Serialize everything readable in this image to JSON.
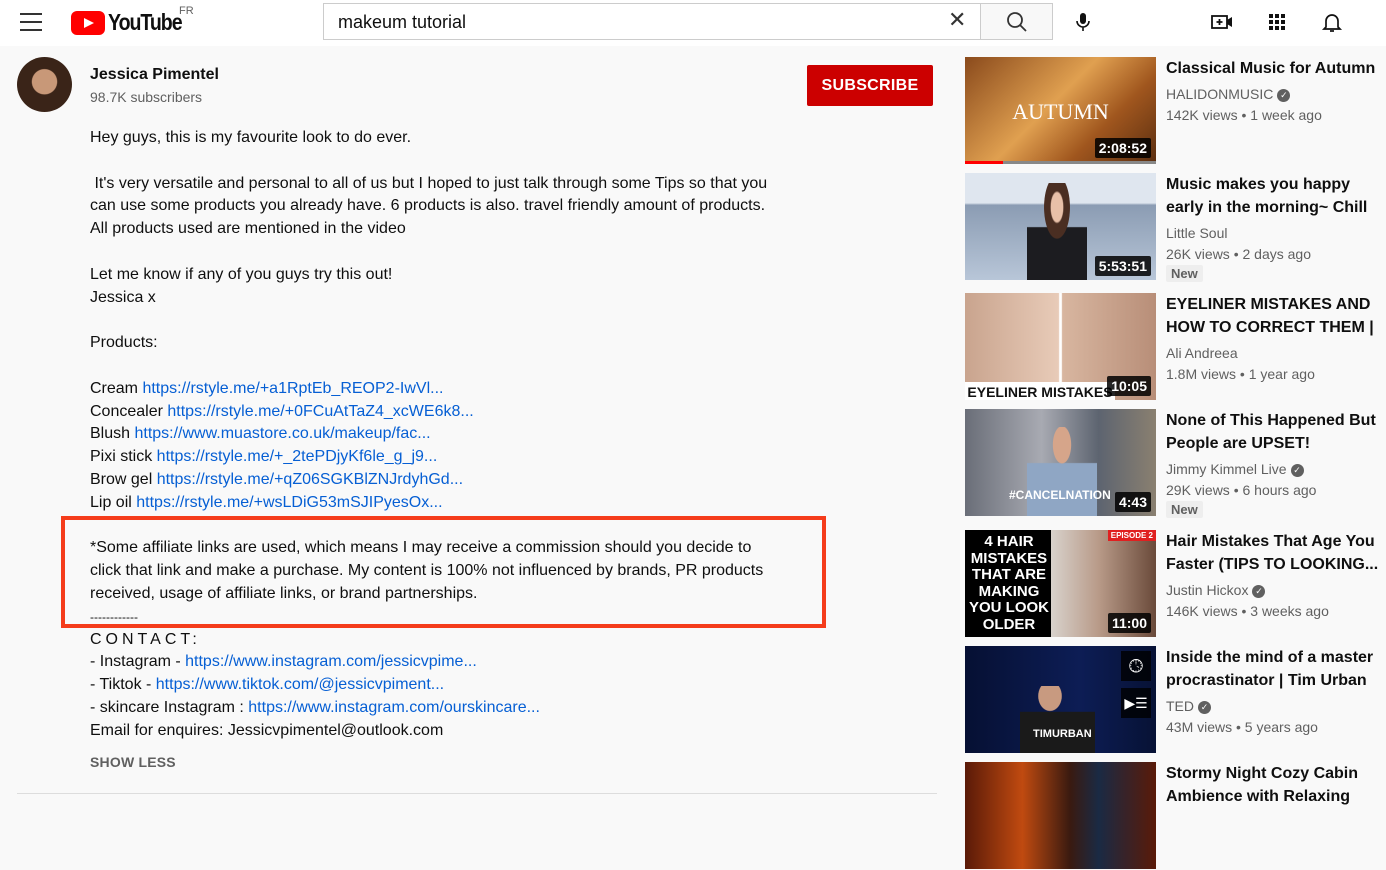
{
  "header": {
    "logo_text": "YouTube",
    "region": "FR",
    "search_value": "makeum tutorial"
  },
  "channel": {
    "name": "Jessica Pimentel",
    "subscribers": "98.7K subscribers",
    "subscribe_label": "SUBSCRIBE"
  },
  "description": {
    "intro": "Hey guys, this is my favourite look to do ever.",
    "p2": [
      " It's very versatile and personal to all of us but I hoped to just talk through some Tips so that you",
      "can use some products you already have. 6 products is also. travel friendly amount of products.",
      "All products used are mentioned in the video"
    ],
    "p3": [
      "Let me know if any of you guys try this out!",
      "Jessica x"
    ],
    "products_heading": "Products:",
    "products": [
      {
        "label": "Cream ",
        "link": "https://rstyle.me/+a1RptEb_REOP2-IwVl..."
      },
      {
        "label": "Concealer ",
        "link": "https://rstyle.me/+0FCuAtTaZ4_xcWE6k8..."
      },
      {
        "label": "Blush ",
        "link": "https://www.muastore.co.uk/makeup/fac..."
      },
      {
        "label": "Pixi stick ",
        "link": "https://rstyle.me/+_2tePDjyKf6le_g_j9..."
      },
      {
        "label": "Brow gel ",
        "link": "https://rstyle.me/+qZ06SGKBlZNJrdyhGd..."
      },
      {
        "label": "Lip oil ",
        "link": "https://rstyle.me/+wsLDiG53mSJIPyesOx..."
      }
    ],
    "affiliate": [
      "*Some affiliate links are used, which means I may receive a commission should you decide to",
      "click that link and make a purchase. My content is 100% not influenced by brands, PR products",
      "received, usage of affiliate links, or brand partnerships."
    ],
    "separator": "------------",
    "contact_heading": "CONTACT:",
    "contacts": [
      {
        "label": "- Instagram - ",
        "link": "https://www.instagram.com/jessicvpime..."
      },
      {
        "label": "- Tiktok - ",
        "link": "https://www.tiktok.com/@jessicvpiment..."
      },
      {
        "label": "- skincare Instagram : ",
        "link": "https://www.instagram.com/ourskincare..."
      }
    ],
    "email": "Email for enquires: Jessicvpimentel@outlook.com",
    "show_less": "SHOW LESS",
    "highlight_color": "#f53c1b"
  },
  "sidebar": [
    {
      "title": "Classical Music for Autumn",
      "channel": "HALIDONMUSIC",
      "verified": true,
      "meta": "142K views • 1 week ago",
      "duration": "2:08:52",
      "thumb_text": "AUTUMN",
      "watched": 0.2
    },
    {
      "title": "Music makes you happy early in the morning~ Chill beats -...",
      "channel": "Little Soul",
      "meta": "26K views • 2 days ago",
      "duration": "5:53:51",
      "badge": "New"
    },
    {
      "title": "EYELINER MISTAKES AND HOW TO CORRECT THEM | A...",
      "channel": "Ali Andreea",
      "meta": "1.8M views • 1 year ago",
      "duration": "10:05",
      "thumb_text": "EYELINER MISTAKES"
    },
    {
      "title": "None of This Happened But People are UPSET!",
      "channel": "Jimmy Kimmel Live",
      "verified": true,
      "meta": "29K views • 6 hours ago",
      "duration": "4:43",
      "badge": "New",
      "thumb_text": "#CANCELNATION"
    },
    {
      "title": "Hair Mistakes That Age You Faster (TIPS TO LOOKING...",
      "channel": "Justin Hickox",
      "verified": true,
      "meta": "146K views • 3 weeks ago",
      "duration": "11:00",
      "thumb_text": "4 HAIR MISTAKES THAT ARE MAKING YOU LOOK OLDER",
      "thumb_tag": "EPISODE 2"
    },
    {
      "title": "Inside the mind of a master procrastinator | Tim Urban",
      "channel": "TED",
      "verified": true,
      "meta": "43M views • 5 years ago",
      "thumb_text": "TIMURBAN"
    },
    {
      "title": "Stormy Night Cozy Cabin Ambience with Relaxing Rain..."
    }
  ]
}
